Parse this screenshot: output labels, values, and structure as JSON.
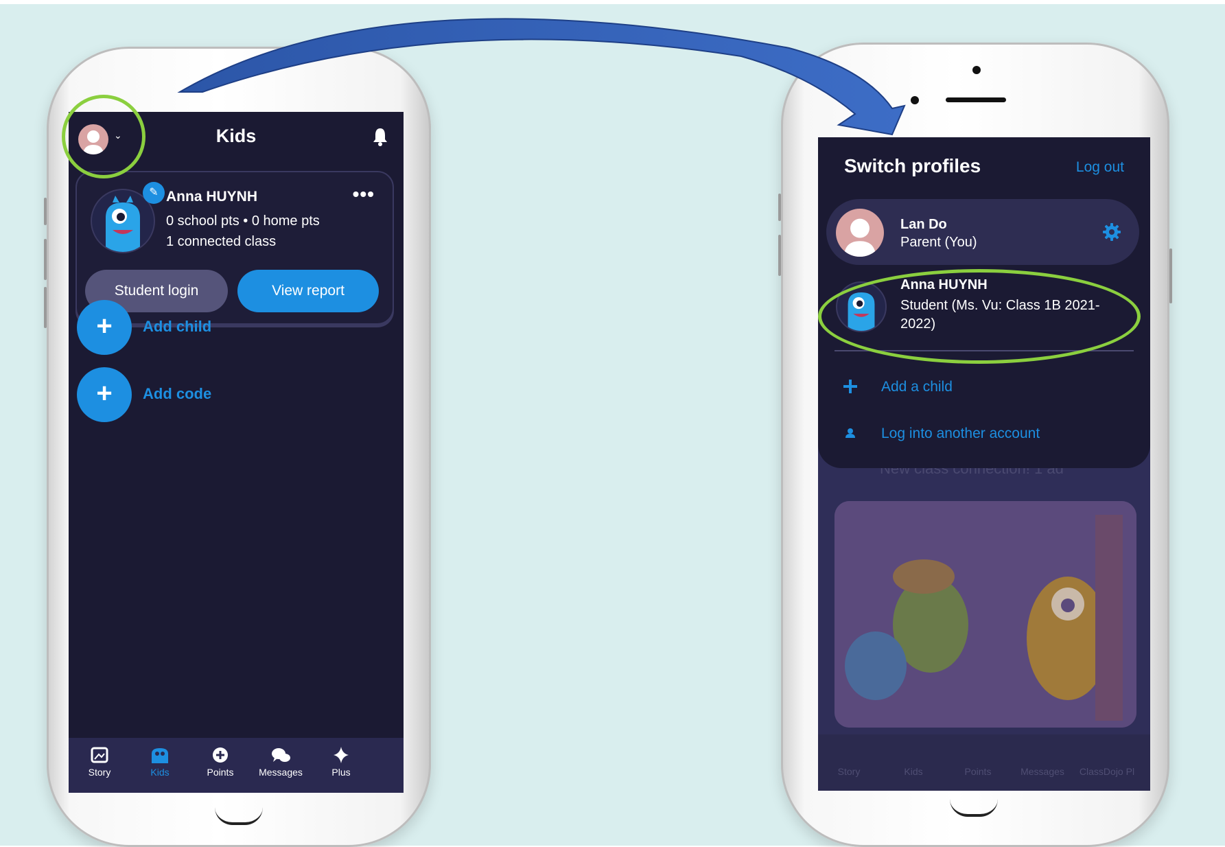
{
  "left_screen": {
    "header": {
      "title": "Kids"
    },
    "kid_card": {
      "name": "Anna HUYNH",
      "points": "0 school pts • 0 home pts",
      "classes": "1 connected class",
      "more": "•••",
      "student_login": "Student login",
      "view_report": "View report"
    },
    "actions": [
      {
        "label": "Add child"
      },
      {
        "label": "Add code"
      }
    ],
    "tabs": [
      {
        "label": "Story",
        "icon": "story-icon",
        "active": false
      },
      {
        "label": "Kids",
        "icon": "kids-icon",
        "active": true
      },
      {
        "label": "Points",
        "icon": "points-icon",
        "active": false
      },
      {
        "label": "Messages",
        "icon": "messages-icon",
        "active": false
      },
      {
        "label": "Plus",
        "icon": "plus-sparkle-icon",
        "active": false
      }
    ]
  },
  "right_screen": {
    "sheet": {
      "title": "Switch profiles",
      "logout": "Log out",
      "parent": {
        "name": "Lan Do",
        "role": "Parent (You)"
      },
      "student": {
        "name": "Anna HUYNH",
        "role": "Student (Ms. Vu: Class 1B 2021-2022)"
      },
      "menu": [
        {
          "label": "Add a child",
          "icon": "plus-icon"
        },
        {
          "label": "Log into another account",
          "icon": "person-icon"
        }
      ]
    },
    "background": {
      "connection_text": "New class connection! 1 ad",
      "tabs": [
        "Story",
        "Kids",
        "Points",
        "Messages",
        "ClassDojo Pl"
      ]
    }
  },
  "colors": {
    "background": "#d9eeee",
    "app_dark": "#1b1a33",
    "accent_blue": "#1d8fe1",
    "highlight_green": "#8bcf3f",
    "arrow_blue": "#2f5fb3"
  }
}
